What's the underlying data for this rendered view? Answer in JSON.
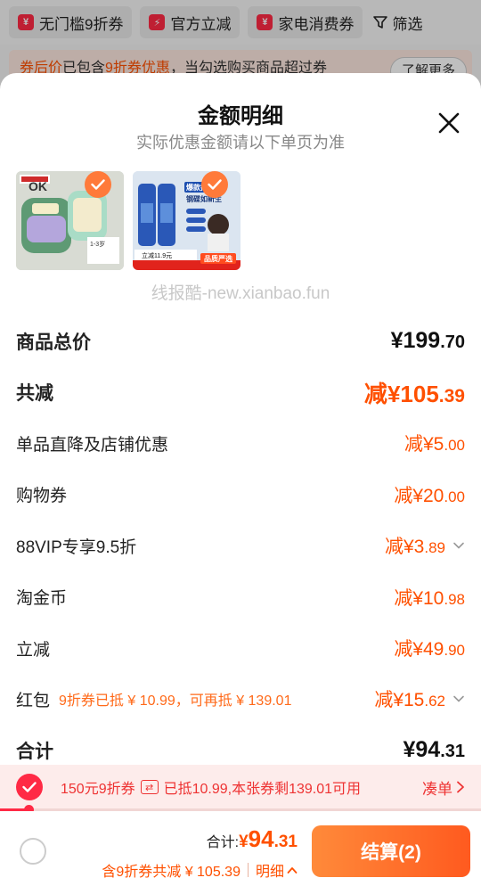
{
  "filter_bar": {
    "chips": [
      {
        "label": "无门槛9折券",
        "icon": "yen-badge-icon"
      },
      {
        "label": "官方立减",
        "icon": "lightning-badge-icon"
      },
      {
        "label": "家电消费券",
        "icon": "yen-badge-icon"
      }
    ],
    "filter_label": "筛选"
  },
  "coupon_note": {
    "highlight": "券后价",
    "text_1": "已包含",
    "highlight_2": "9折券优惠",
    "text_2": "，当勾选购买商品超过券",
    "learn_more": "了解更多"
  },
  "sheet": {
    "title": "金额明细",
    "subtitle": "实际优惠金额请以下单页为准",
    "watermark": "线报酷-new.xianbao.fun",
    "thumbnails": [
      {
        "caption_age": "1-3岁",
        "badge": "OK"
      },
      {
        "caption_badge": "爆款推荐",
        "caption_line": "钢碟如新生",
        "price_tag": "立减11.9元",
        "footer": "品质严选"
      }
    ],
    "rows": [
      {
        "label": "商品总价",
        "prefix": "",
        "yen": "¥",
        "int": "199",
        "dec": ".70",
        "style": "black",
        "bold": true
      },
      {
        "label": "共减",
        "prefix": "减",
        "yen": "¥",
        "int": "105",
        "dec": ".39",
        "style": "big",
        "bold": true
      },
      {
        "label": "单品直降及店铺优惠",
        "prefix": "减",
        "yen": "¥",
        "int": "5",
        "dec": ".00",
        "style": "normal"
      },
      {
        "label": "购物券",
        "prefix": "减",
        "yen": "¥",
        "int": "20",
        "dec": ".00",
        "style": "normal"
      },
      {
        "label": "88VIP专享9.5折",
        "prefix": "减",
        "yen": "¥",
        "int": "3",
        "dec": ".89",
        "style": "normal",
        "chevron": true
      },
      {
        "label": "淘金币",
        "prefix": "减",
        "yen": "¥",
        "int": "10",
        "dec": ".98",
        "style": "normal"
      },
      {
        "label": "立减",
        "prefix": "减",
        "yen": "¥",
        "int": "49",
        "dec": ".90",
        "style": "normal"
      },
      {
        "label": "红包",
        "note": "9折券已抵 ¥ 10.99，可再抵 ¥ 139.01",
        "prefix": "减",
        "yen": "¥",
        "int": "15",
        "dec": ".62",
        "style": "normal",
        "chevron": true
      },
      {
        "label": "合计",
        "prefix": "",
        "yen": "¥",
        "int": "94",
        "dec": ".31",
        "style": "black",
        "bold": true
      }
    ]
  },
  "coupon_strip": {
    "coupon_name": "150元9折券",
    "swap_glyph": "⇄",
    "status": "已抵10.99,本张券剩139.01可用",
    "action": "凑单",
    "progress_fraction": 0.06
  },
  "bottom_bar": {
    "total_label": "合计:",
    "total_yen": "¥",
    "total_int": "94",
    "total_dec": ".31",
    "savings": "含9折券共减 ¥ 105.39",
    "detail": "明细",
    "checkout": "结算(2)"
  },
  "colors": {
    "accent": "#ff5000",
    "red": "#ff2a45",
    "checkout_start": "#ff8a3a",
    "checkout_end": "#ff5a1f"
  }
}
